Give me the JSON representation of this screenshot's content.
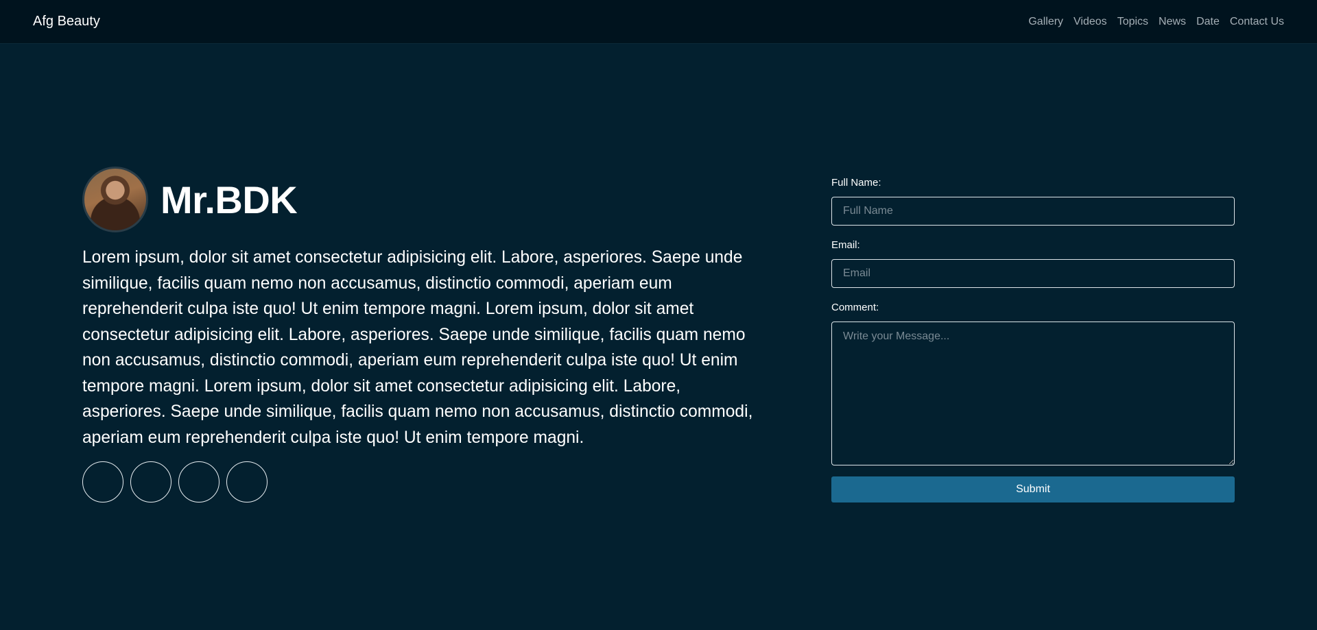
{
  "navbar": {
    "brand": "Afg Beauty",
    "links": [
      "Gallery",
      "Videos",
      "Topics",
      "News",
      "Date",
      "Contact Us"
    ]
  },
  "profile": {
    "name": "Mr.BDK",
    "bio": "Lorem ipsum, dolor sit amet consectetur adipisicing elit. Labore, asperiores. Saepe unde similique, facilis quam nemo non accusamus, distinctio commodi, aperiam eum reprehenderit culpa iste quo! Ut enim tempore magni. Lorem ipsum, dolor sit amet consectetur adipisicing elit. Labore, asperiores. Saepe unde similique, facilis quam nemo non accusamus, distinctio commodi, aperiam eum reprehenderit culpa iste quo! Ut enim tempore magni. Lorem ipsum, dolor sit amet consectetur adipisicing elit. Labore, asperiores. Saepe unde similique, facilis quam nemo non accusamus, distinctio commodi, aperiam eum reprehenderit culpa iste quo! Ut enim tempore magni."
  },
  "form": {
    "full_name_label": "Full Name:",
    "full_name_placeholder": "Full Name",
    "email_label": "Email:",
    "email_placeholder": "Email",
    "comment_label": "Comment:",
    "comment_placeholder": "Write your Message...",
    "submit_label": "Submit"
  },
  "colors": {
    "background": "#03202f",
    "navbar": "#00131e",
    "accent": "#1b6990"
  }
}
